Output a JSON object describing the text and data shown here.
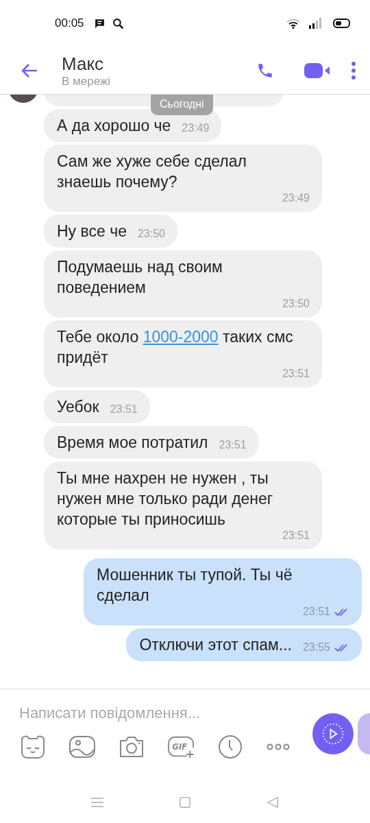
{
  "status_bar": {
    "time": "00:05"
  },
  "header": {
    "name": "Макс",
    "status": "В мережі"
  },
  "date_chip": "Сьогодні",
  "messages": [
    {
      "kind": "incoming",
      "parts": [
        {
          "text": "А да хорошо че",
          "link": false
        }
      ],
      "time": "23:49"
    },
    {
      "kind": "incoming",
      "parts": [
        {
          "text": "Сам же хуже себе сделал знаешь почему?",
          "link": false
        }
      ],
      "time": "23:49"
    },
    {
      "kind": "incoming",
      "parts": [
        {
          "text": "Ну все че",
          "link": false
        }
      ],
      "time": "23:50"
    },
    {
      "kind": "incoming",
      "parts": [
        {
          "text": "Подумаешь над своим поведением",
          "link": false
        }
      ],
      "time": "23:50"
    },
    {
      "kind": "incoming",
      "parts": [
        {
          "text": "Тебе около ",
          "link": false
        },
        {
          "text": "1000-2000",
          "link": true
        },
        {
          "text": " таких смс придёт",
          "link": false
        }
      ],
      "time": "23:51"
    },
    {
      "kind": "incoming",
      "parts": [
        {
          "text": "Уебок",
          "link": false
        }
      ],
      "time": "23:51"
    },
    {
      "kind": "incoming",
      "parts": [
        {
          "text": "Время мое потратил",
          "link": false
        }
      ],
      "time": "23:51"
    },
    {
      "kind": "incoming",
      "parts": [
        {
          "text": "Ты мне нахрен не нужен , ты нужен мне только ради денег которые ты приносишь",
          "link": false
        }
      ],
      "time": "23:51"
    },
    {
      "kind": "outgoing",
      "parts": [
        {
          "text": "Мошенник ты тупой. Ты чё сделал",
          "link": false
        }
      ],
      "time": "23:51",
      "read": true
    },
    {
      "kind": "outgoing",
      "parts": [
        {
          "text": "Отключи этот спам...",
          "link": false
        }
      ],
      "time": "23:55",
      "read": true
    }
  ],
  "composer": {
    "placeholder": "Написати повідомлення...",
    "gif_label": "GIF"
  }
}
